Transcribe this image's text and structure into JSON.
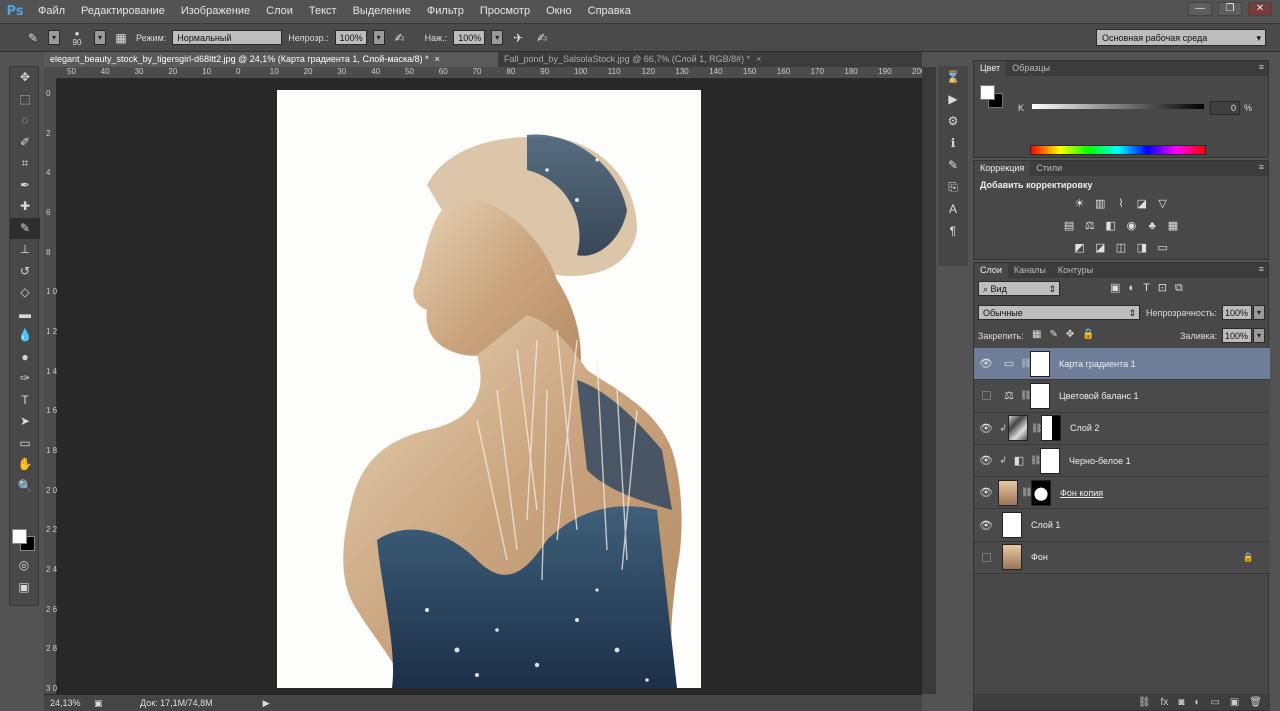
{
  "app": {
    "logo": "Ps"
  },
  "menubar": [
    "Файл",
    "Редактирование",
    "Изображение",
    "Слои",
    "Текст",
    "Выделение",
    "Фильтр",
    "Просмотр",
    "Окно",
    "Справка"
  ],
  "window_controls": [
    "—",
    "❐",
    "✕"
  ],
  "options": {
    "brush_size": "90",
    "mode_label": "Режим:",
    "mode_value": "Нормальный",
    "opacity_label": "Непрозр.:",
    "opacity_value": "100%",
    "flow_label": "Наж.:",
    "flow_value": "100%",
    "workspace": "Основная рабочая среда"
  },
  "doc_tabs": [
    {
      "label": "elegant_beauty_stock_by_tigersgirl-d68ltt2.jpg @ 24,1% (Карта градиента 1, Слой-маска/8) *",
      "close": "×"
    },
    {
      "label": "Fall_pond_by_SalsolaStock.jpg @ 66,7% (Слой 1, RGB/8#) *",
      "close": "×"
    }
  ],
  "ruler_top": [
    "50",
    "40",
    "30",
    "20",
    "10",
    "0",
    "10",
    "20",
    "30",
    "40",
    "50",
    "60",
    "70",
    "80",
    "90",
    "100",
    "110",
    "120",
    "130",
    "140",
    "150",
    "160",
    "170",
    "180",
    "190",
    "200"
  ],
  "ruler_left": [
    "0",
    "2",
    "4",
    "6",
    "8",
    "1 0",
    "1 2",
    "1 4",
    "1 6",
    "1 8",
    "2 0",
    "2 2",
    "2 4",
    "2 6",
    "2 8",
    "3 0"
  ],
  "status": {
    "zoom": "24,13%",
    "doc": "Док: 17,1M/74,8M"
  },
  "color_panel": {
    "tabs": [
      "Цвет",
      "Образцы"
    ],
    "k_label": "K",
    "k_value": "0",
    "k_unit": "%"
  },
  "adjust_panel": {
    "tabs": [
      "Коррекция",
      "Стили"
    ],
    "title": "Добавить корректировку",
    "icons": [
      [
        "brightness-icon",
        "levels-icon",
        "curves-icon",
        "exposure-icon",
        "vibrance-icon"
      ],
      [
        "hue-saturation-icon",
        "color-balance-icon",
        "black-white-icon",
        "photo-filter-icon",
        "channel-mixer-icon",
        "color-lookup-icon"
      ],
      [
        "invert-icon",
        "posterize-icon",
        "threshold-icon",
        "selective-color-icon",
        "gradient-map-icon"
      ]
    ]
  },
  "layers_panel": {
    "tabs": [
      "Слои",
      "Каналы",
      "Контуры"
    ],
    "filter_kind": "Вид",
    "blend_mode": "Обычные",
    "opacity_label": "Непрозрачность:",
    "opacity_value": "100%",
    "lock_label": "Закрепить:",
    "fill_label": "Заливка:",
    "fill_value": "100%",
    "layers": [
      {
        "name": "Карта градиента 1",
        "visible": true,
        "selected": true,
        "kind": "adjustment"
      },
      {
        "name": "Цветовой баланс 1",
        "visible": false,
        "selected": false,
        "kind": "adjustment"
      },
      {
        "name": "Слой 2",
        "visible": true,
        "selected": false,
        "kind": "pixel-masked"
      },
      {
        "name": "Черно-белое 1",
        "visible": true,
        "selected": false,
        "kind": "adjustment"
      },
      {
        "name": "Фон копия",
        "visible": true,
        "selected": false,
        "kind": "pixel-masked"
      },
      {
        "name": "Слой 1",
        "visible": true,
        "selected": false,
        "kind": "pixel"
      },
      {
        "name": "Фон",
        "visible": false,
        "selected": false,
        "kind": "background"
      }
    ]
  }
}
